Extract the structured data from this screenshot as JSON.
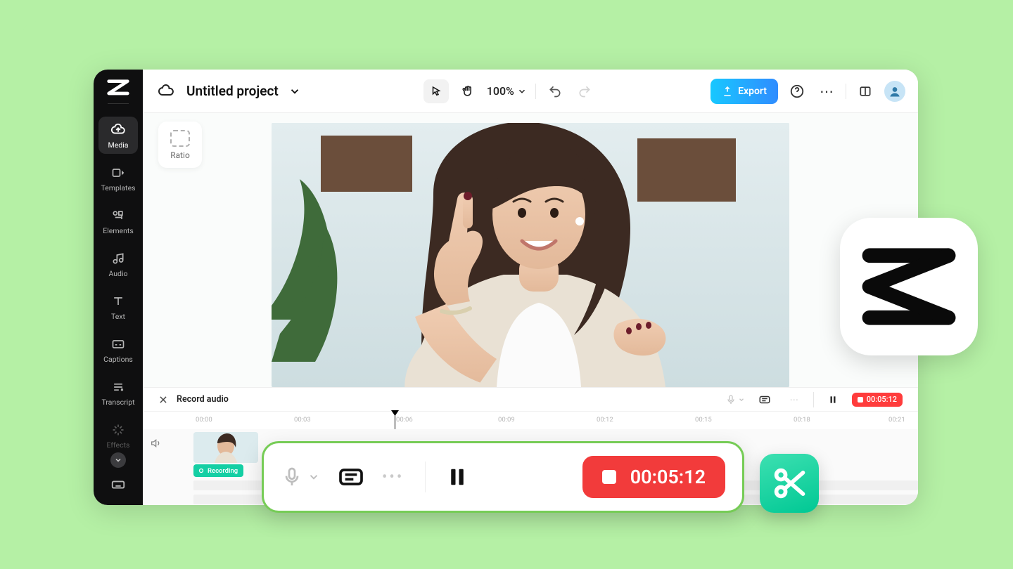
{
  "project": {
    "title": "Untitled project",
    "zoom": "100%"
  },
  "topbar": {
    "export_label": "Export"
  },
  "sidebar": {
    "media": "Media",
    "templates": "Templates",
    "elements": "Elements",
    "audio": "Audio",
    "text": "Text",
    "captions": "Captions",
    "transcript": "Transcript",
    "effects": "Effects"
  },
  "ratio_label": "Ratio",
  "panel": {
    "title": "Record audio",
    "small_time": "00:05:12"
  },
  "ruler": {
    "labels": [
      "00:00",
      "00:03",
      "00:06",
      "00:09",
      "00:12",
      "00:15",
      "00:18",
      "00:21"
    ]
  },
  "timeline": {
    "recording_chip": "Recording"
  },
  "float_record": {
    "time": "00:05:12"
  }
}
